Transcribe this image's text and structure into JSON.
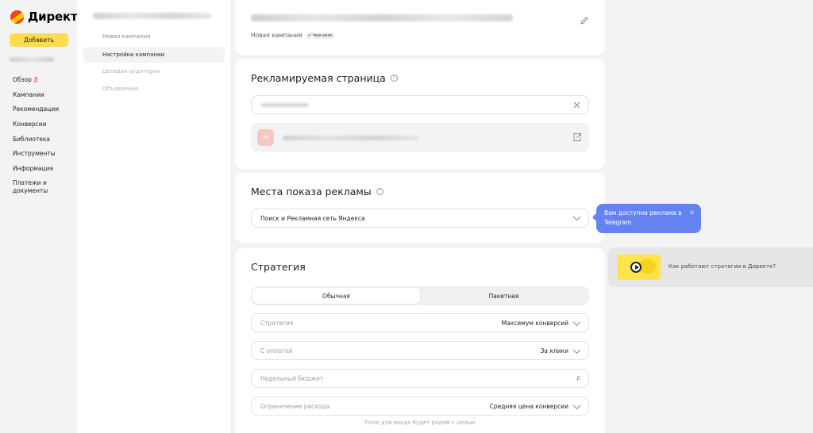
{
  "brand": {
    "name": "Директ",
    "add_button": "Добавить"
  },
  "nav": {
    "items": [
      {
        "label": "Обзор",
        "badge": "β"
      },
      {
        "label": "Кампании"
      },
      {
        "label": "Рекомендации"
      },
      {
        "label": "Конверсии"
      },
      {
        "label": "Библиотека"
      },
      {
        "label": "Инструменты"
      },
      {
        "label": "Информация"
      },
      {
        "label": "Платежи и документы"
      }
    ]
  },
  "steps": [
    {
      "label": "Новая кампания",
      "state": "done"
    },
    {
      "label": "Настройки кампании",
      "state": "active"
    },
    {
      "label": "Целевая аудитория",
      "state": "pending"
    },
    {
      "label": "Объявление",
      "state": "pending"
    }
  ],
  "campaign": {
    "subtitle": "Новая кампания",
    "status": "Черновик"
  },
  "promoted_page": {
    "title": "Рекламируемая страница",
    "favicon_text": "Mi"
  },
  "placements": {
    "title": "Места показа рекламы",
    "value": "Поиск и Рекламная сеть Яндекса",
    "tooltip": "Вам доступна реклама в Telegram"
  },
  "strategy": {
    "title": "Стратегия",
    "tabs": [
      "Обычная",
      "Пакетная"
    ],
    "fields": [
      {
        "label": "Стратегия",
        "value": "Максимум конверсий"
      },
      {
        "label": "С оплатой",
        "value": "За клики"
      },
      {
        "label": "Недельный бюджет",
        "value": "₽"
      },
      {
        "label": "Ограничение расхода",
        "value": "Средняя цена конверсии"
      }
    ],
    "hint": "Поле для ввода будет рядом с целью"
  },
  "video": {
    "text": "Как работают стратегии в Директе?"
  },
  "colors": {
    "accent_yellow": "#ffdb4d",
    "tooltip_blue": "#6583f0",
    "beta_red": "#ff3333"
  }
}
